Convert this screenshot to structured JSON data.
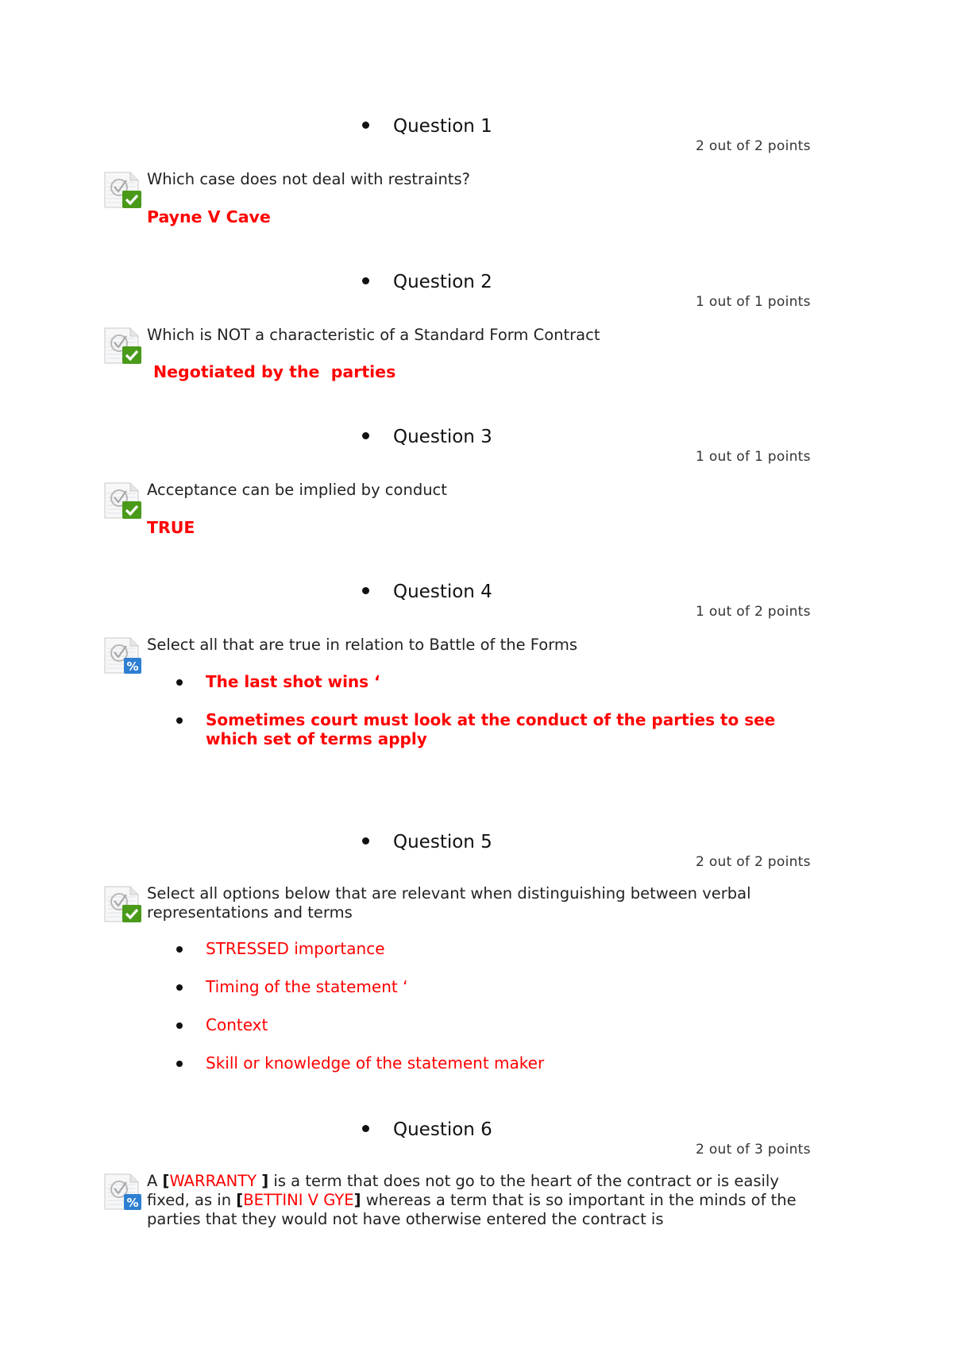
{
  "questions": [
    {
      "title": "Question 1",
      "points": "2 out of 2 points",
      "status_icon": "correct-check-icon",
      "text": "Which case does not deal with restraints?",
      "answer": "Payne V Cave"
    },
    {
      "title": "Question 2",
      "points": "1 out of 1 points",
      "status_icon": "correct-check-icon",
      "text": "Which is NOT a characteristic of a Standard Form Contract",
      "answer": "Negotiated by the  parties"
    },
    {
      "title": "Question 3",
      "points": "1 out of 1 points",
      "status_icon": "correct-check-icon",
      "text": "Acceptance can be implied by conduct",
      "answer": "TRUE"
    },
    {
      "title": "Question 4",
      "points": "1 out of 2 points",
      "status_icon": "partial-credit-icon",
      "text": "Select all that are true in relation to Battle of the Forms",
      "options": [
        "The last shot wins ‘",
        "Sometimes court must look at the conduct of the parties to see which set of terms apply"
      ]
    },
    {
      "title": "Question 5",
      "points": "2 out of 2 points",
      "status_icon": "correct-check-icon",
      "text": "Select all options below that are relevant when distinguishing between verbal representations and terms",
      "options": [
        "STRESSED importance",
        "Timing of the statement ‘",
        "Context",
        "Skill or knowledge of the statement maker"
      ]
    },
    {
      "title": "Question 6",
      "points": "2 out of 3 points",
      "status_icon": "partial-credit-icon",
      "text_parts": {
        "p1": "A ",
        "b1_open": "[",
        "a1": "WARRANTY ",
        "b1_close": "]",
        "p2": " is a term that does not go to the heart of the contract or is easily fixed, as in ",
        "b2_open": "[",
        "a2": "BETTINI V GYE",
        "b2_close": "]",
        "p3": " whereas a term that is so important in the minds of the parties that they would not have otherwise entered the contract is"
      }
    }
  ]
}
